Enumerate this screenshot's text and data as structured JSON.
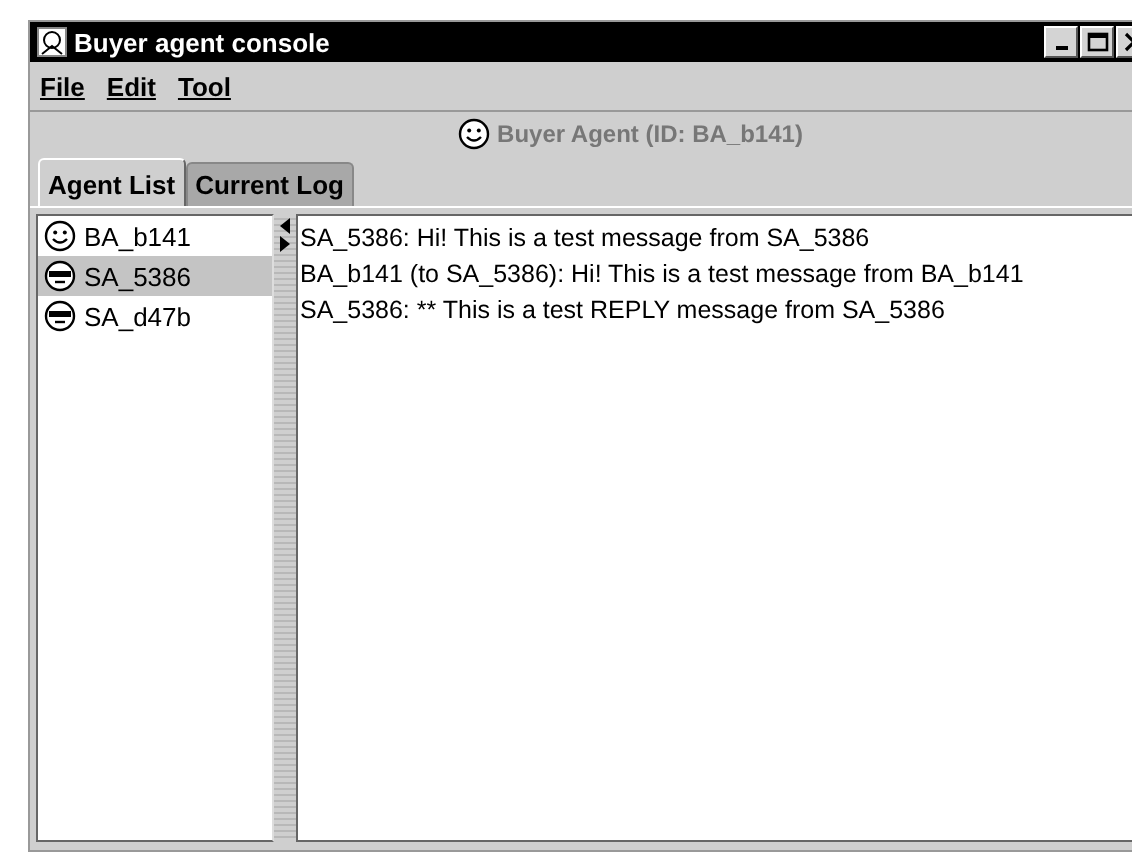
{
  "window": {
    "title": "Buyer agent console"
  },
  "menu": [
    {
      "label": "File"
    },
    {
      "label": "Edit"
    },
    {
      "label": "Tool"
    }
  ],
  "header": {
    "label": "Buyer Agent (ID: BA_b141)"
  },
  "tabs": [
    {
      "label": "Agent List",
      "selected": true
    },
    {
      "label": "Current Log",
      "selected": false
    }
  ],
  "agents": [
    {
      "name": "BA_b141",
      "kind": "buyer",
      "selected": false
    },
    {
      "name": "SA_5386",
      "kind": "seller",
      "selected": true
    },
    {
      "name": "SA_d47b",
      "kind": "seller",
      "selected": false
    }
  ],
  "log": [
    "SA_5386: Hi! This is a test message from SA_5386",
    "BA_b141 (to SA_5386): Hi! This is a test message from BA_b141",
    "SA_5386: ** This is a test REPLY message from SA_5386"
  ]
}
